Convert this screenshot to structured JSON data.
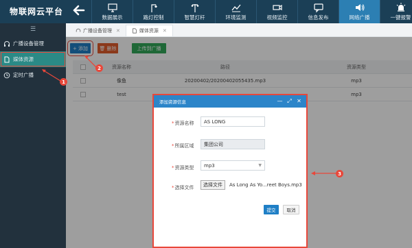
{
  "app": {
    "title": "物联网云平台"
  },
  "nav": [
    {
      "label": "数据展示",
      "icon": "monitor-icon"
    },
    {
      "label": "路灯控制",
      "icon": "lamp-icon"
    },
    {
      "label": "智慧灯杆",
      "icon": "pole-icon"
    },
    {
      "label": "环境监测",
      "icon": "chart-icon"
    },
    {
      "label": "视频监控",
      "icon": "camera-icon"
    },
    {
      "label": "信息发布",
      "icon": "message-icon"
    },
    {
      "label": "网络广播",
      "icon": "speaker-icon",
      "active": true
    },
    {
      "label": "一键报警",
      "icon": "alarm-icon"
    }
  ],
  "sidebar": {
    "toggle": "☰",
    "items": [
      {
        "label": "广播设备管理",
        "icon": "headset-icon"
      },
      {
        "label": "媒体资源",
        "icon": "file-icon",
        "active": true
      },
      {
        "label": "定时广播",
        "icon": "clock-icon"
      }
    ]
  },
  "tabs": [
    {
      "label": "广播设备管理",
      "close": "✕"
    },
    {
      "label": "媒体资源",
      "close": "✕",
      "active": true
    }
  ],
  "toolbar": {
    "add_label": "+ 添加",
    "delete_label": "🗑 删除",
    "upload_label": "上传到广播"
  },
  "table": {
    "headers": [
      "资源名称",
      "路径",
      "资源类型"
    ],
    "rows": [
      {
        "name": "像鱼",
        "path": "20200402/20200402055435.mp3",
        "type": "mp3"
      },
      {
        "name": "test",
        "path": "",
        "type": "mp3"
      }
    ]
  },
  "dialog": {
    "title": "添加资源信息",
    "controls": {
      "minimize": "—",
      "maximize": "⤢",
      "close": "✕"
    },
    "fields": {
      "name_label": "资源名称",
      "name_value": "AS LONG",
      "area_label": "所属区域",
      "area_value": "集团公司",
      "type_label": "资源类型",
      "type_value": "mp3",
      "file_label": "选择文件",
      "file_button": "选择文件",
      "file_name": "As Long As Yo...reet Boys.mp3"
    },
    "ok_label": "提交",
    "cancel_label": "取消"
  },
  "annotations": [
    "1",
    "2",
    "3"
  ],
  "colors": {
    "header_bg": "#1b3f56",
    "sidebar_bg": "#22313d",
    "sidebar_active": "#2b8a86",
    "accent_blue": "#1f7fc6",
    "delete_orange": "#e05d2c",
    "upload_green": "#33a95a",
    "annotation_red": "#e8473a"
  }
}
